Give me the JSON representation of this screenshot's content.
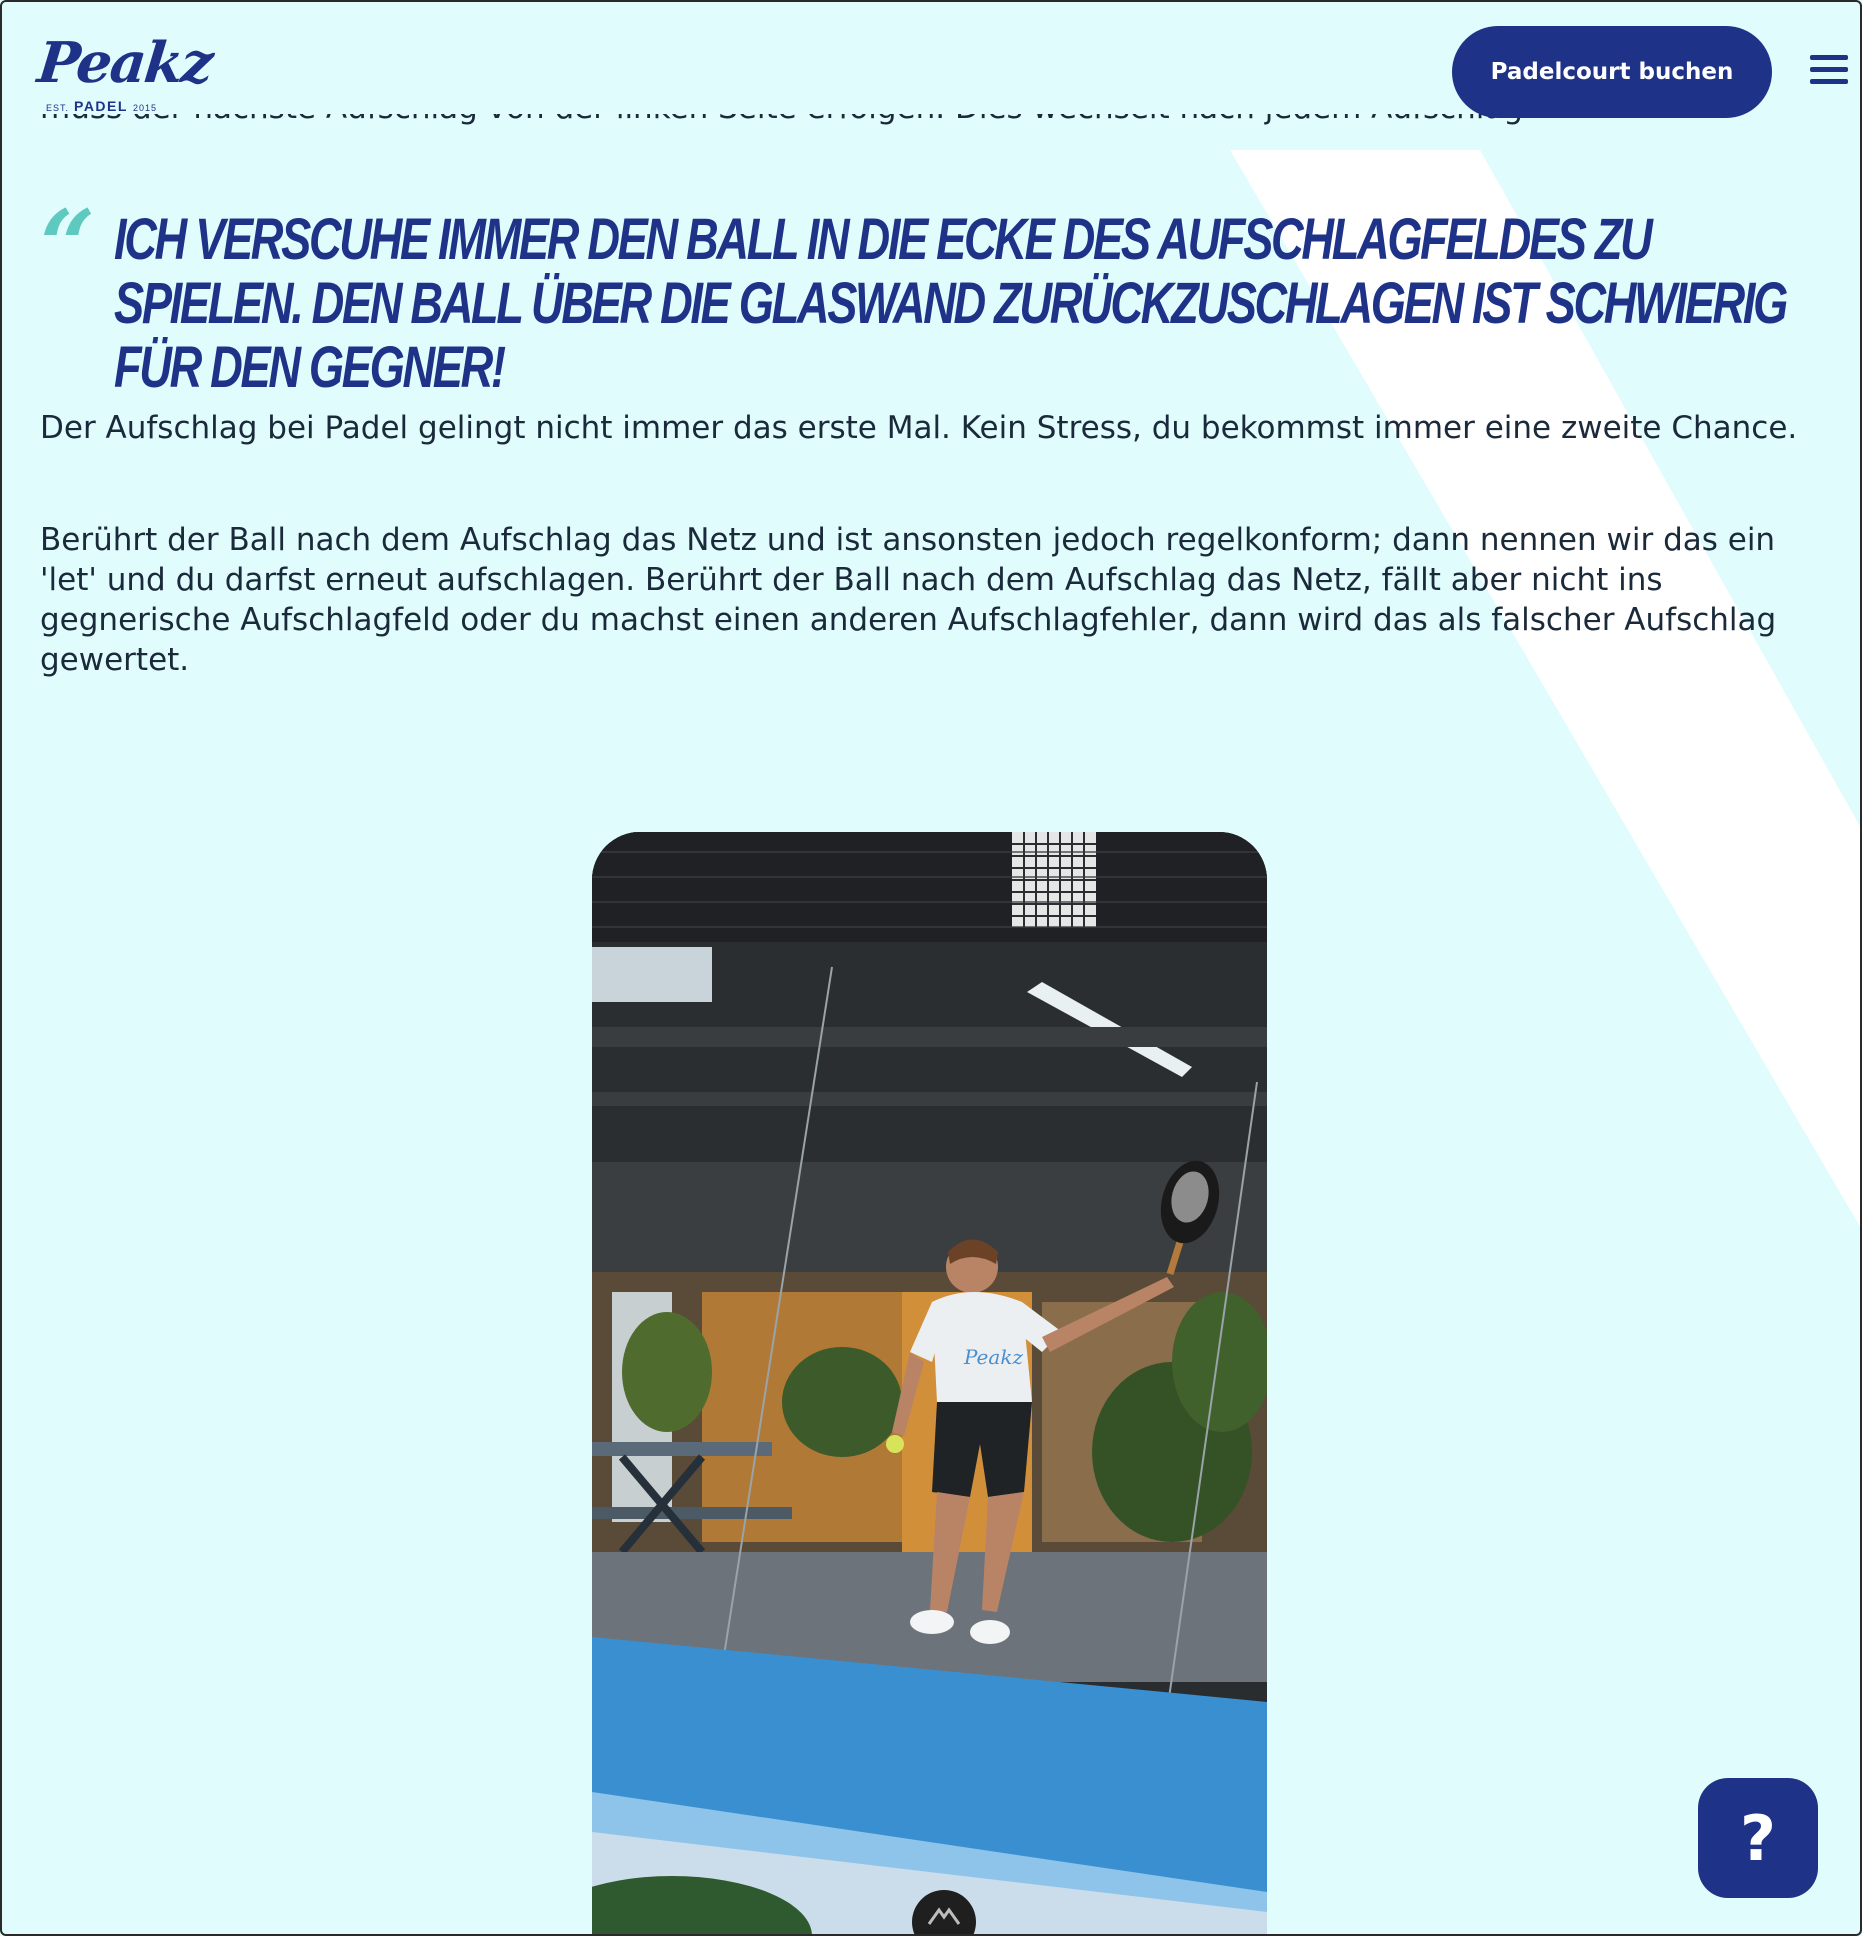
{
  "header": {
    "logo": {
      "script": "Peakz",
      "est": "EST.",
      "brand": "PADEL",
      "year": "2015"
    },
    "book_button_label": "Padelcourt buchen",
    "menu_icon": "hamburger-menu-icon"
  },
  "article": {
    "cut_off_line": "muss der nächste Aufschlag von der linken Seite erfolgen. Dies wechselt nach jedem Aufschlag.",
    "quote": "Ich verscuhe immer den Ball in die Ecke des Aufschlagfeldes zu spielen. Den Ball über die Glaswand zurückzuschlagen ist schwierig für den Gegner!",
    "paragraph_1": "Der Aufschlag bei Padel gelingt nicht immer das erste Mal. Kein Stress, du bekommst immer eine zweite Chance.",
    "paragraph_2": "Berührt der Ball nach dem Aufschlag das Netz und ist ansonsten jedoch regelkonform; dann nennen wir das ein 'let' und du darfst erneut aufschlagen. Berührt der Ball nach dem Aufschlag das Netz, fällt aber nicht ins gegnerische Aufschlagfeld oder du machst einen anderen Aufschlagfehler, dann wird das als falscher Aufschlag gewertet."
  },
  "photo": {
    "shirt_text": "Peakz"
  },
  "help_button": {
    "label": "?"
  },
  "icons": {
    "quote": "quote-mark-icon",
    "help": "help-icon",
    "video": "mountain-logo-icon"
  },
  "colors": {
    "background": "#e0fcfd",
    "brand_navy": "#1e3287",
    "quote_accent": "#5ec9be",
    "stripe": "#ffffff",
    "text": "#1b2a3a"
  }
}
